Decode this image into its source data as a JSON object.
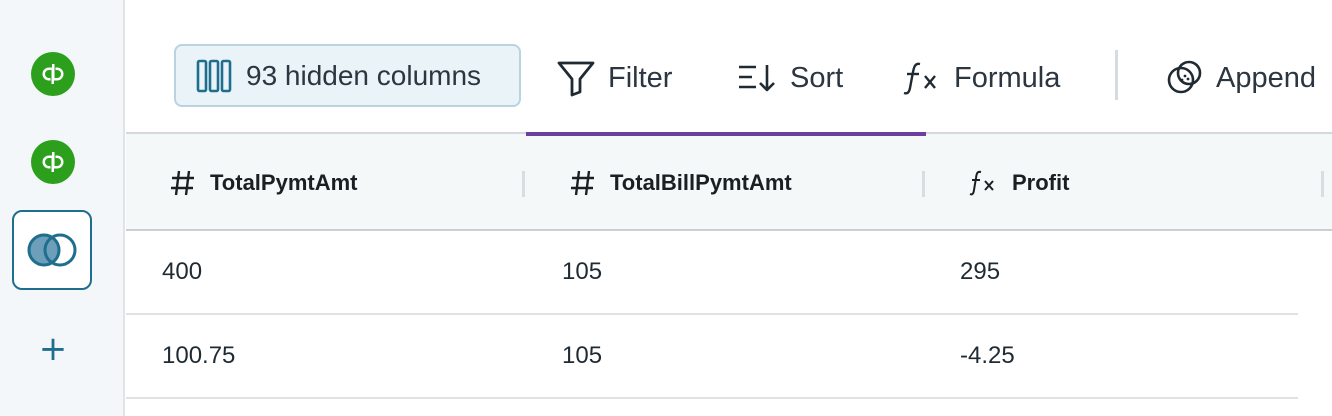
{
  "sidebar": {
    "sources": [
      {
        "name": "quickbooks-logo-1",
        "icon": "quickbooks-icon",
        "color": "#2ca01c"
      },
      {
        "name": "quickbooks-logo-2",
        "icon": "quickbooks-icon",
        "color": "#2ca01c"
      }
    ],
    "merge_icon": "venn-merge-icon",
    "add_icon": "plus-icon",
    "add_label": "+"
  },
  "toolbar": {
    "hidden_columns_label": "93 hidden columns",
    "filter_label": "Filter",
    "sort_label": "Sort",
    "formula_label": "Formula",
    "append_label": "Append"
  },
  "table": {
    "columns": [
      {
        "type": "number",
        "type_glyph": "#",
        "name": "TotalPymtAmt"
      },
      {
        "type": "number",
        "type_glyph": "#",
        "name": "TotalBillPymtAmt"
      },
      {
        "type": "formula",
        "type_glyph": "fx",
        "name": "Profit"
      }
    ],
    "rows": [
      [
        "400",
        "105",
        "295"
      ],
      [
        "100.75",
        "105",
        "-4.25"
      ]
    ],
    "selected_accent": "#6b3fa0"
  },
  "colors": {
    "brand": "#1f6e8e",
    "quickbooks_green": "#2ca01c"
  }
}
